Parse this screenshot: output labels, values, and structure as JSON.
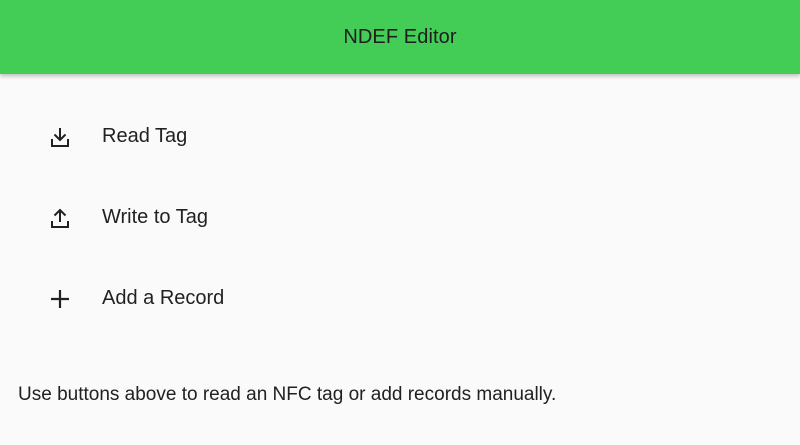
{
  "app_bar": {
    "title": "NDEF Editor",
    "color": "#43cd57"
  },
  "menu": {
    "items": [
      {
        "label": "Read Tag",
        "icon": "download-icon"
      },
      {
        "label": "Write to Tag",
        "icon": "upload-icon"
      },
      {
        "label": "Add a Record",
        "icon": "plus-icon"
      }
    ]
  },
  "hint": {
    "text": "Use buttons above to read an NFC tag or add records manually."
  }
}
